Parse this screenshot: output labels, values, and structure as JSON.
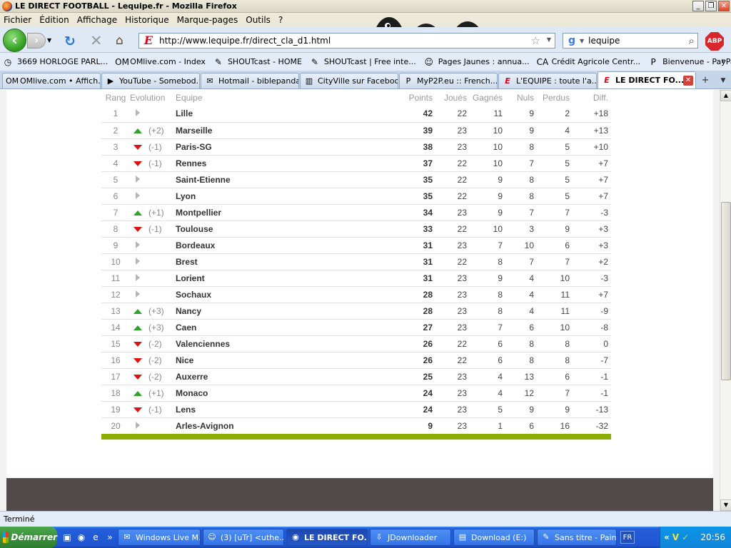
{
  "window": {
    "title": "LE DIRECT FOOTBALL - Lequipe.fr - Mozilla Firefox",
    "minimize": "_",
    "maximize": "❐",
    "close": "✕"
  },
  "menu": [
    "Fichier",
    "Édition",
    "Affichage",
    "Historique",
    "Marque-pages",
    "Outils",
    "?"
  ],
  "nav": {
    "url": "http://www.lequipe.fr/direct_cla_d1.html",
    "search_value": "lequipe",
    "abp_label": "ABP"
  },
  "bookmarks": [
    {
      "label": "3669 HORLOGE PARL...",
      "icon": "clock-icon",
      "glyph": "◷"
    },
    {
      "label": "OMlive.com - Index",
      "icon": "omlive-icon",
      "glyph": "OM"
    },
    {
      "label": "SHOUTcast - HOME",
      "icon": "shoutcast-icon",
      "glyph": "✎"
    },
    {
      "label": "SHOUTcast | Free inte...",
      "icon": "shoutcast-icon",
      "glyph": "✎"
    },
    {
      "label": "Pages Jaunes : annua...",
      "icon": "pagesjaunes-icon",
      "glyph": "☺"
    },
    {
      "label": "Crédit Agricole Centr...",
      "icon": "credit-agricole-icon",
      "glyph": "CA"
    },
    {
      "label": "Bienvenue - PayPal",
      "icon": "paypal-icon",
      "glyph": "P"
    }
  ],
  "bookmarks_more": "»",
  "tabs": [
    {
      "label": "OMlive.com • Affich...",
      "glyph": "OM",
      "active": false
    },
    {
      "label": "YouTube - Somebod...",
      "glyph": "▶",
      "active": false
    },
    {
      "label": "Hotmail - biblepanda...",
      "glyph": "✉",
      "active": false
    },
    {
      "label": "CityVille sur Facebook",
      "glyph": "▥",
      "active": false
    },
    {
      "label": "MyP2P.eu :: French...",
      "glyph": "P",
      "active": false
    },
    {
      "label": "L'EQUIPE : toute l'a...",
      "glyph": "E",
      "active": false
    },
    {
      "label": "LE DIRECT FO...",
      "glyph": "E",
      "active": true
    }
  ],
  "table": {
    "headers": {
      "rang": "Rang",
      "evolution": "Evolution",
      "equipe": "Equipe",
      "points": "Points",
      "joues": "Joués",
      "gagnes": "Gagnés",
      "nuls": "Nuls",
      "perdus": "Perdus",
      "diff": "Diff."
    },
    "rows": [
      {
        "rang": "1",
        "trend": "flat",
        "evo": "",
        "team": "Lille",
        "pts": "42",
        "j": "22",
        "g": "11",
        "n": "9",
        "p": "2",
        "d": "+18"
      },
      {
        "rang": "2",
        "trend": "up",
        "evo": "(+2)",
        "team": "Marseille",
        "pts": "39",
        "j": "23",
        "g": "10",
        "n": "9",
        "p": "4",
        "d": "+13"
      },
      {
        "rang": "3",
        "trend": "down",
        "evo": "(-1)",
        "team": "Paris-SG",
        "pts": "38",
        "j": "23",
        "g": "10",
        "n": "8",
        "p": "5",
        "d": "+10"
      },
      {
        "rang": "4",
        "trend": "down",
        "evo": "(-1)",
        "team": "Rennes",
        "pts": "37",
        "j": "22",
        "g": "10",
        "n": "7",
        "p": "5",
        "d": "+7"
      },
      {
        "rang": "5",
        "trend": "flat",
        "evo": "",
        "team": "Saint-Etienne",
        "pts": "35",
        "j": "22",
        "g": "9",
        "n": "8",
        "p": "5",
        "d": "+7"
      },
      {
        "rang": "6",
        "trend": "flat",
        "evo": "",
        "team": "Lyon",
        "pts": "35",
        "j": "22",
        "g": "9",
        "n": "8",
        "p": "5",
        "d": "+7"
      },
      {
        "rang": "7",
        "trend": "up",
        "evo": "(+1)",
        "team": "Montpellier",
        "pts": "34",
        "j": "23",
        "g": "9",
        "n": "7",
        "p": "7",
        "d": "-3"
      },
      {
        "rang": "8",
        "trend": "down",
        "evo": "(-1)",
        "team": "Toulouse",
        "pts": "33",
        "j": "22",
        "g": "10",
        "n": "3",
        "p": "9",
        "d": "+3"
      },
      {
        "rang": "9",
        "trend": "flat",
        "evo": "",
        "team": "Bordeaux",
        "pts": "31",
        "j": "23",
        "g": "7",
        "n": "10",
        "p": "6",
        "d": "+3"
      },
      {
        "rang": "10",
        "trend": "flat",
        "evo": "",
        "team": "Brest",
        "pts": "31",
        "j": "22",
        "g": "8",
        "n": "7",
        "p": "7",
        "d": "+2"
      },
      {
        "rang": "11",
        "trend": "flat",
        "evo": "",
        "team": "Lorient",
        "pts": "31",
        "j": "23",
        "g": "9",
        "n": "4",
        "p": "10",
        "d": "-3"
      },
      {
        "rang": "12",
        "trend": "flat",
        "evo": "",
        "team": "Sochaux",
        "pts": "28",
        "j": "23",
        "g": "8",
        "n": "4",
        "p": "11",
        "d": "+7"
      },
      {
        "rang": "13",
        "trend": "up",
        "evo": "(+3)",
        "team": "Nancy",
        "pts": "28",
        "j": "23",
        "g": "8",
        "n": "4",
        "p": "11",
        "d": "-9"
      },
      {
        "rang": "14",
        "trend": "up",
        "evo": "(+3)",
        "team": "Caen",
        "pts": "27",
        "j": "23",
        "g": "7",
        "n": "6",
        "p": "10",
        "d": "-8"
      },
      {
        "rang": "15",
        "trend": "down",
        "evo": "(-2)",
        "team": "Valenciennes",
        "pts": "26",
        "j": "22",
        "g": "6",
        "n": "8",
        "p": "8",
        "d": "0"
      },
      {
        "rang": "16",
        "trend": "down",
        "evo": "(-2)",
        "team": "Nice",
        "pts": "26",
        "j": "22",
        "g": "6",
        "n": "8",
        "p": "8",
        "d": "-7"
      },
      {
        "rang": "17",
        "trend": "down",
        "evo": "(-2)",
        "team": "Auxerre",
        "pts": "25",
        "j": "23",
        "g": "4",
        "n": "13",
        "p": "6",
        "d": "-1"
      },
      {
        "rang": "18",
        "trend": "up",
        "evo": "(+1)",
        "team": "Monaco",
        "pts": "24",
        "j": "23",
        "g": "4",
        "n": "12",
        "p": "7",
        "d": "-1"
      },
      {
        "rang": "19",
        "trend": "down",
        "evo": "(-1)",
        "team": "Lens",
        "pts": "24",
        "j": "23",
        "g": "5",
        "n": "9",
        "p": "9",
        "d": "-13"
      },
      {
        "rang": "20",
        "trend": "flat",
        "evo": "",
        "team": "Arles-Avignon",
        "pts": "9",
        "j": "23",
        "g": "1",
        "n": "6",
        "p": "16",
        "d": "-32"
      }
    ]
  },
  "status": "Terminé",
  "taskbar": {
    "start_label": "Démarrer",
    "quicklaunch_more": "»",
    "tasks": [
      {
        "label": "Windows Live M...",
        "glyph": "✉",
        "active": false,
        "width": 116
      },
      {
        "label": "(3) [uTr] <uthe...",
        "glyph": "☺",
        "active": false,
        "width": 114
      },
      {
        "label": "LE DIRECT FO...",
        "glyph": "◉",
        "active": true,
        "width": 114
      },
      {
        "label": "JDownloader",
        "glyph": "⇩",
        "active": false,
        "width": 114
      },
      {
        "label": "Download (E:)",
        "glyph": "▤",
        "active": false,
        "width": 114
      },
      {
        "label": "Sans titre - Paint",
        "glyph": "✎",
        "active": false,
        "width": 112
      }
    ],
    "lang": "FR",
    "tray_more": "«",
    "clock": "20:56"
  },
  "colors": {
    "up": "#2aa52a",
    "down": "#e01010",
    "flat": "#b5b5b5",
    "bar": "#8cac00",
    "footer": "#514a49"
  }
}
